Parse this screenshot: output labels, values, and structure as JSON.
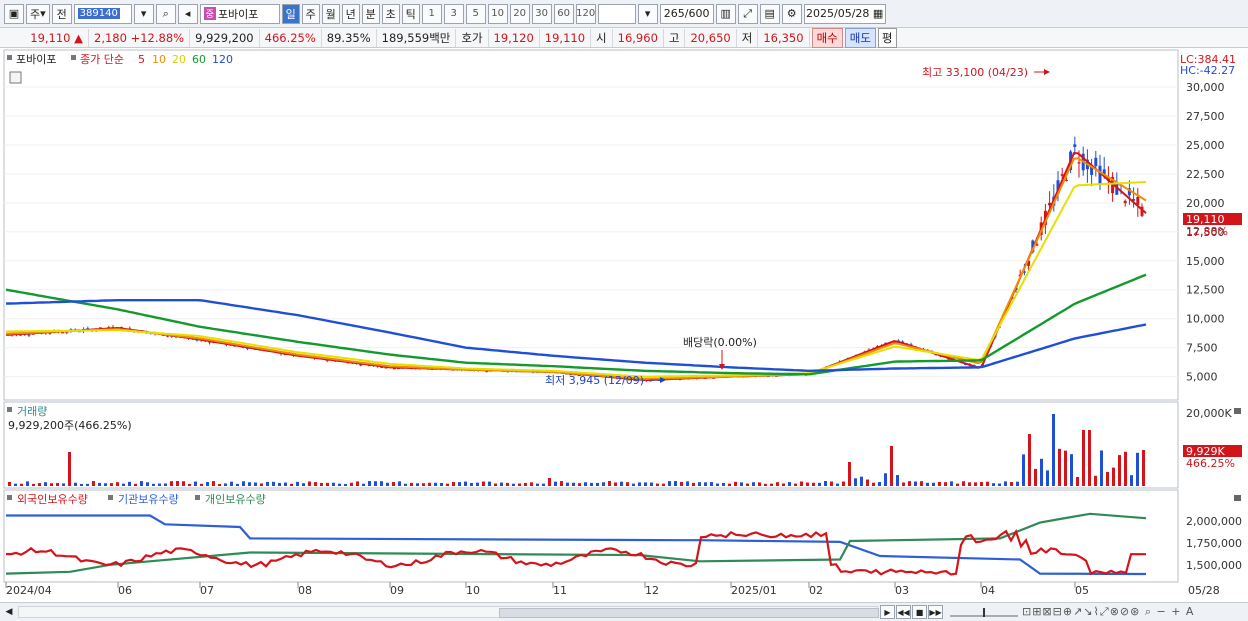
{
  "toolbar": {
    "market": "주",
    "prefix": "전",
    "code": "389140",
    "stock_name": "포바이포",
    "name_badge": "중",
    "periods": [
      "일",
      "주",
      "월",
      "년",
      "분",
      "초",
      "틱"
    ],
    "selected_period": "일",
    "intervals": [
      "1",
      "3",
      "5",
      "10",
      "20",
      "30",
      "60",
      "120"
    ],
    "count": "265",
    "count_total": "/600",
    "date": "2025/05/28"
  },
  "quote": {
    "price": "19,110",
    "change": "2,180",
    "change_pct": "+12.88%",
    "volume": "9,929,200",
    "volume_pct": "466.25%",
    "ratio": "89.35%",
    "amount": "189,559백만",
    "bid_label": "호가",
    "bid1": "19,120",
    "bid2": "19,110",
    "open_label": "시",
    "open": "16,960",
    "high_label": "고",
    "high": "20,650",
    "low_label": "저",
    "low": "16,350",
    "buy_label": "매수",
    "sell_label": "매도",
    "avg_label": "평"
  },
  "price_panel": {
    "legend_name": "포바이포",
    "legend_type": "종가 단순",
    "ma": [
      {
        "label": "5",
        "color": "#d4141b"
      },
      {
        "label": "10",
        "color": "#f08c00"
      },
      {
        "label": "20",
        "color": "#e6e000"
      },
      {
        "label": "60",
        "color": "#139a2c"
      },
      {
        "label": "120",
        "color": "#1f4fd6"
      }
    ],
    "lc": "LC:384.41",
    "hc": "HC:-42.27",
    "high_annotation": "최고 33,100 (04/23)",
    "low_annotation": "최저 3,945 (12/09)",
    "dividend_annotation": "배당락(0.00%)",
    "y_ticks": [
      "30,000",
      "27,500",
      "25,000",
      "22,500",
      "20,000",
      "17,500",
      "15,000",
      "12,500",
      "10,000",
      "7,500",
      "5,000"
    ],
    "current_price": "19,110",
    "current_pct": "12.88%"
  },
  "volume_panel": {
    "title": "거래량",
    "summary": "9,929,200주(466.25%)",
    "y_tick": "20,000K",
    "current": "9,929K",
    "current_pct": "466.25%"
  },
  "holding_panel": {
    "series": [
      {
        "name": "외국인보유수량",
        "color": "#d4141b"
      },
      {
        "name": "기관보유수량",
        "color": "#2f5fd8"
      },
      {
        "name": "개인보유수량",
        "color": "#2e8b57"
      }
    ],
    "y_ticks": [
      "2,000,000",
      "1,750,000",
      "1,500,000"
    ]
  },
  "x_axis": {
    "labels": [
      "2024/04",
      "06",
      "07",
      "08",
      "09",
      "10",
      "11",
      "12",
      "2025/01",
      "02",
      "03",
      "04",
      "05",
      "05/28"
    ]
  },
  "chart_data": {
    "type": "line",
    "title": "",
    "xlabel": "",
    "ylabel": "",
    "ylim": [
      3500,
      32500
    ],
    "x": [
      "2024/04",
      "06",
      "07",
      "08",
      "09",
      "10",
      "11",
      "12",
      "2025/01",
      "02",
      "03",
      "04",
      "05",
      "05/28"
    ],
    "series": [
      {
        "name": "5",
        "values": [
          8600,
          9200,
          8200,
          6800,
          5800,
          5600,
          5400,
          4700,
          5000,
          5200,
          8100,
          5700,
          24500,
          19110
        ]
      },
      {
        "name": "10",
        "values": [
          8700,
          9100,
          8300,
          6900,
          5900,
          5600,
          5400,
          4800,
          5000,
          5200,
          7900,
          6100,
          24000,
          20200
        ]
      },
      {
        "name": "20",
        "values": [
          8900,
          9000,
          8500,
          7100,
          6100,
          5700,
          5500,
          5000,
          5100,
          5300,
          7600,
          6400,
          21500,
          21800
        ]
      },
      {
        "name": "60",
        "values": [
          12500,
          10800,
          9300,
          8000,
          6900,
          6200,
          5900,
          5500,
          5300,
          5200,
          6300,
          6400,
          11300,
          13800
        ]
      },
      {
        "name": "120",
        "values": [
          11300,
          11600,
          11600,
          10300,
          8800,
          7500,
          6800,
          6200,
          5800,
          5500,
          5700,
          5800,
          8300,
          9500
        ]
      }
    ]
  }
}
